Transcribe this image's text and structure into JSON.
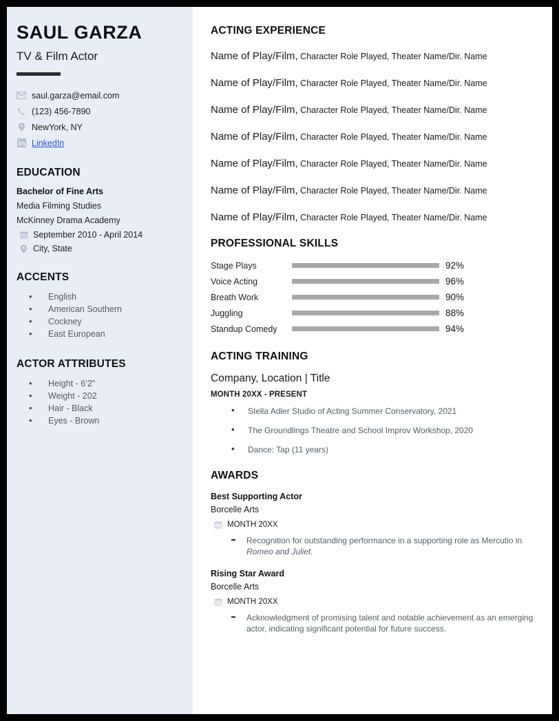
{
  "sidebar": {
    "name": "SAUL GARZA",
    "role": "TV & Film Actor",
    "contacts": [
      {
        "icon": "envelope-icon",
        "text": "saul.garza@email.com",
        "link": false
      },
      {
        "icon": "phone-icon",
        "text": "(123) 456-7890",
        "link": false
      },
      {
        "icon": "location-pin-icon",
        "text": "NewYork, NY",
        "link": false
      },
      {
        "icon": "linkedin-icon",
        "text": "LinkedIn",
        "link": true
      }
    ],
    "education": {
      "heading": "EDUCATION",
      "degree": "Bachelor of Fine Arts",
      "field": "Media Filming Studies",
      "school": "McKinney Drama Academy",
      "dates": "September 2010 - April 2014",
      "location": "City, State"
    },
    "accents": {
      "heading": "ACCENTS",
      "items": [
        "English",
        "American Southern",
        "Cockney",
        "East European"
      ]
    },
    "attributes": {
      "heading": "ACTOR ATTRIBUTES",
      "items": [
        "Height - 6’2”",
        "Weight - 202",
        "Hair - Black",
        "Eyes -  Brown"
      ]
    }
  },
  "main": {
    "experience": {
      "heading": "ACTING EXPERIENCE",
      "entries": [
        {
          "play": "Name of Play/Film,",
          "rest": " Character Role Played, Theater Name/Dir. Name"
        },
        {
          "play": "Name of Play/Film,",
          "rest": " Character Role Played, Theater Name/Dir. Name"
        },
        {
          "play": "Name of Play/Film,",
          "rest": " Character Role Played, Theater Name/Dir. Name"
        },
        {
          "play": "Name of Play/Film,",
          "rest": " Character Role Played, Theater Name/Dir. Name"
        },
        {
          "play": "Name of Play/Film,",
          "rest": " Character Role Played, Theater Name/Dir. Name"
        },
        {
          "play": "Name of Play/Film,",
          "rest": " Character Role Played, Theater Name/Dir. Name"
        },
        {
          "play": "Name of Play/Film,",
          "rest": " Character Role Played, Theater Name/Dir. Name"
        }
      ]
    },
    "skills": {
      "heading": "PROFESSIONAL SKILLS",
      "items": [
        {
          "name": "Stage Plays",
          "value": 92,
          "label": "92%"
        },
        {
          "name": "Voice Acting",
          "value": 96,
          "label": "96%"
        },
        {
          "name": "Breath Work",
          "value": 90,
          "label": "90%"
        },
        {
          "name": "Juggling",
          "value": 88,
          "label": "88%"
        },
        {
          "name": "Standup Comedy",
          "value": 94,
          "label": "94%"
        }
      ]
    },
    "training": {
      "heading": "ACTING TRAINING",
      "company": "Company, Location | Title",
      "date": "MONTH 20XX - PRESENT",
      "items": [
        "Stella Adler Studio of Acting Summer Conservatory, 2021",
        "The Groundlings Theatre and School Improv Workshop, 2020",
        "Dance: Tap (11 years)"
      ]
    },
    "awards": {
      "heading": "AWARDS",
      "entries": [
        {
          "title": "Best Supporting Actor",
          "org": "Borcelle Arts",
          "date": "MONTH 20XX",
          "desc_before": "Recognition for outstanding performance in a supporting role as Mercutio in ",
          "desc_italic": "Romeo and Juliet.",
          "desc_after": ""
        },
        {
          "title": "Rising Star Award",
          "org": "Borcelle Arts",
          "date": "MONTH 20XX",
          "desc_before": "Acknowledgment of promising talent and notable achievement as an emerging actor, indicating significant potential for future success.",
          "desc_italic": "",
          "desc_after": ""
        }
      ]
    }
  },
  "colors": {
    "sidebar_bg": "#e8edf6",
    "page_bg": "#ffffff",
    "frame": "#000000",
    "accent_bar": "#2b2b2b",
    "link": "#2757d8",
    "skill_fill": "#2e2e2e",
    "skill_track": "#a8a8a8"
  }
}
